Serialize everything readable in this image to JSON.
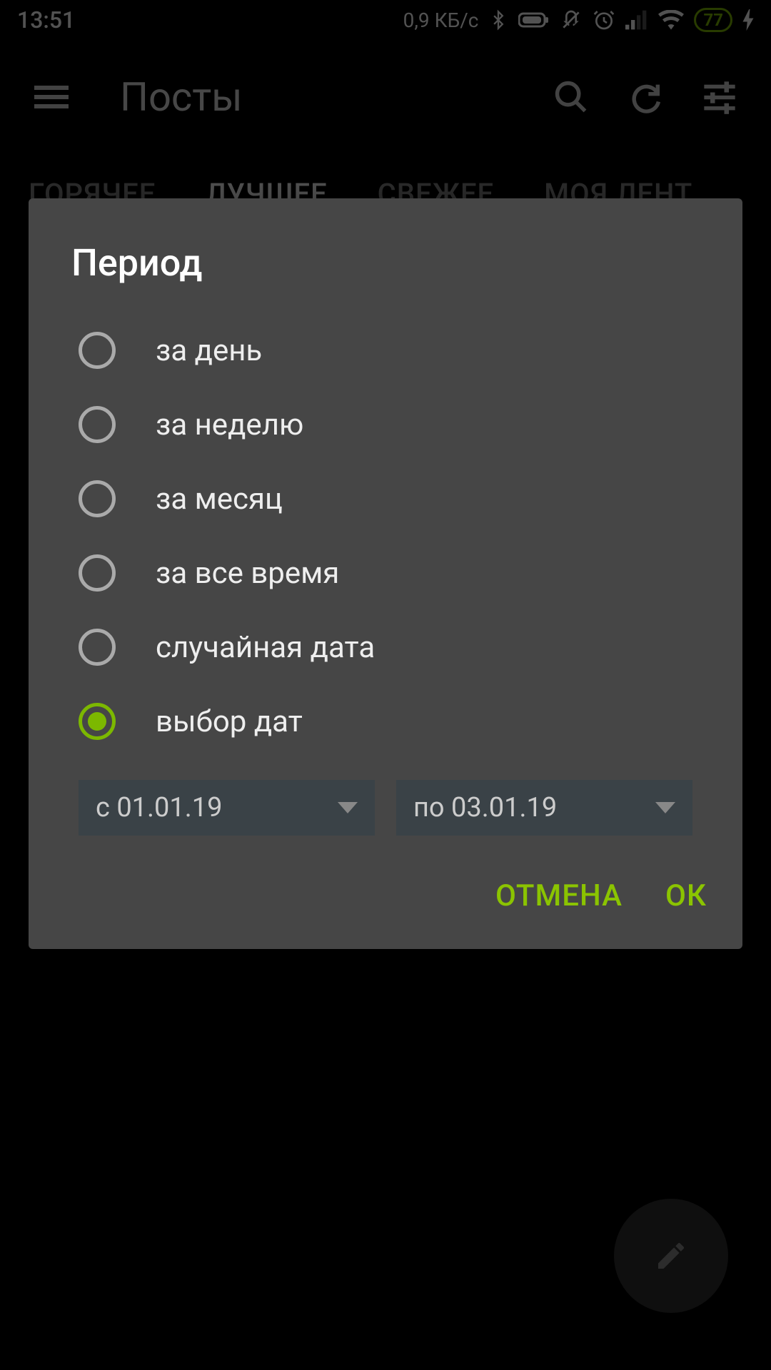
{
  "status": {
    "time": "13:51",
    "speed": "0,9 КБ/с",
    "battery": "77"
  },
  "appbar": {
    "title": "Посты"
  },
  "tabs": {
    "items": [
      "ГОРЯЧЕЕ",
      "ЛУЧШЕЕ",
      "СВЕЖЕЕ",
      "МОЯ ЛЕНТ"
    ],
    "active_index": 1
  },
  "dialog": {
    "title": "Период",
    "options": [
      {
        "label": "за день",
        "selected": false
      },
      {
        "label": "за неделю",
        "selected": false
      },
      {
        "label": "за месяц",
        "selected": false
      },
      {
        "label": "за все время",
        "selected": false
      },
      {
        "label": "случайная дата",
        "selected": false
      },
      {
        "label": "выбор дат",
        "selected": true
      }
    ],
    "date_from": "с 01.01.19",
    "date_to": "по 03.01.19",
    "cancel": "ОТМЕНА",
    "ok": "ОК"
  }
}
